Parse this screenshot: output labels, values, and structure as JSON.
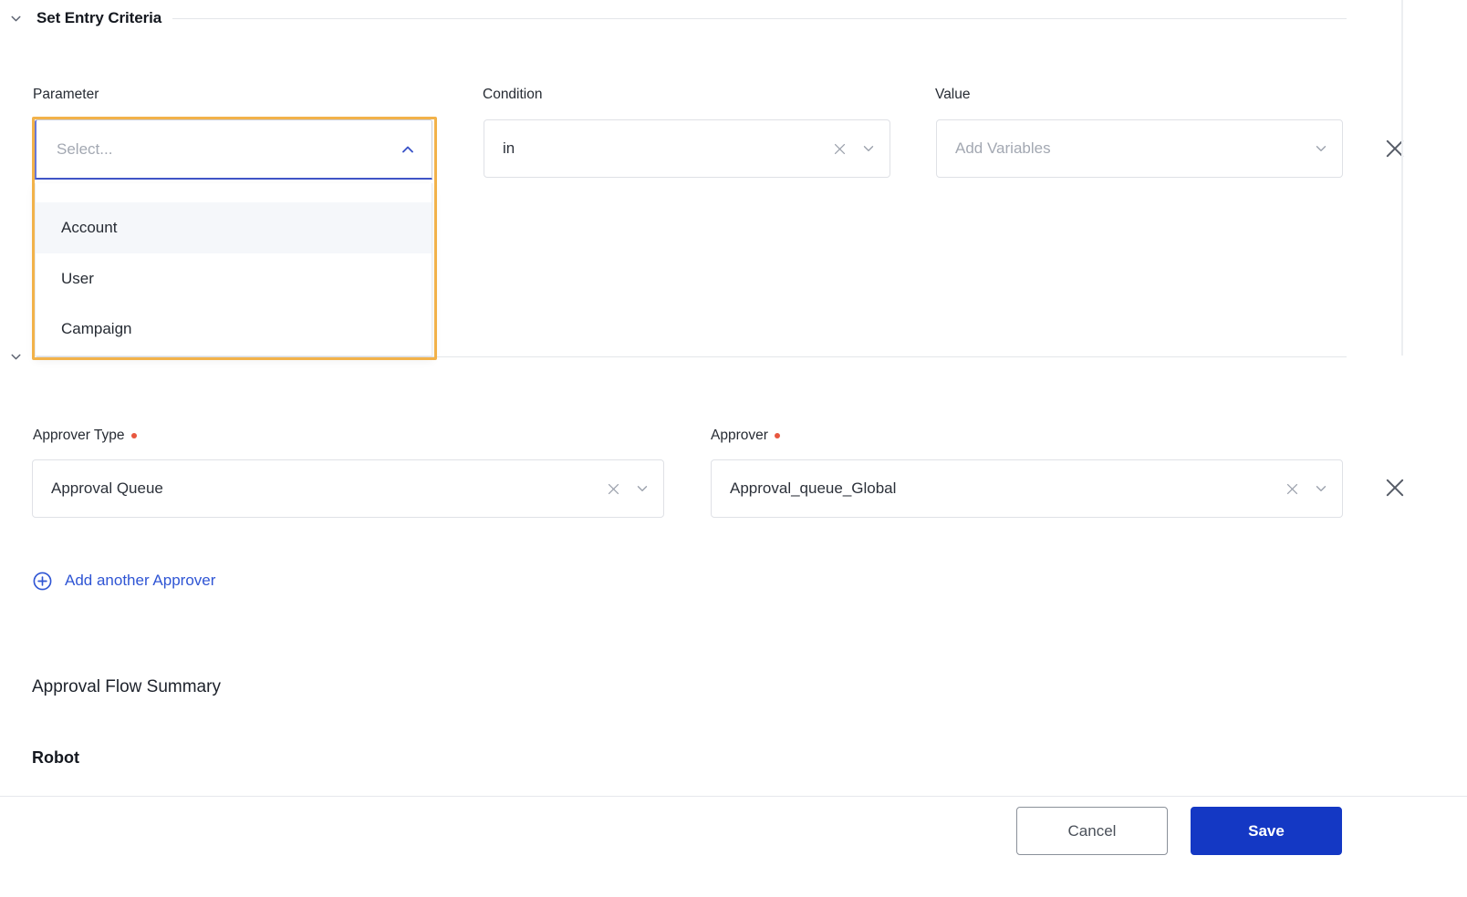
{
  "sections": {
    "entry_criteria": {
      "title": "Set Entry Criteria",
      "chevron_icon": "chevron-down-icon"
    },
    "approver_steps": {
      "chevron_icon": "chevron-down-icon"
    }
  },
  "criteria_row": {
    "parameter": {
      "label": "Parameter",
      "placeholder": "Select...",
      "value": "",
      "caret_icon": "chevron-up-icon",
      "state": "open"
    },
    "condition": {
      "label": "Condition",
      "value": "in",
      "clear_icon": "close-icon",
      "caret_icon": "chevron-down-icon"
    },
    "value": {
      "label": "Value",
      "placeholder": "Add Variables",
      "value": "",
      "caret_icon": "chevron-down-icon"
    },
    "remove_icon": "close-icon"
  },
  "parameter_dropdown": {
    "options": [
      {
        "label": "Account",
        "active": true
      },
      {
        "label": "User",
        "active": false
      },
      {
        "label": "Campaign",
        "active": false
      }
    ]
  },
  "approver_row": {
    "approver_type": {
      "label": "Approver Type",
      "required": true,
      "value": "Approval Queue",
      "clear_icon": "close-icon",
      "caret_icon": "chevron-down-icon"
    },
    "approver": {
      "label": "Approver",
      "required": true,
      "value": "Approval_queue_Global",
      "clear_icon": "close-icon",
      "caret_icon": "chevron-down-icon"
    },
    "remove_icon": "close-icon"
  },
  "add_approver": {
    "label": "Add another Approver",
    "icon": "plus-circle-icon"
  },
  "summary": {
    "title": "Approval Flow Summary",
    "step_name": "Robot"
  },
  "footer": {
    "cancel_label": "Cancel",
    "save_label": "Save"
  },
  "colors": {
    "accent_blue": "#1438c4",
    "link_blue": "#2f55d4",
    "focus_orange": "#f2b24a",
    "required_red": "#e8573f",
    "option_active_bg": "#f5f7fa"
  }
}
